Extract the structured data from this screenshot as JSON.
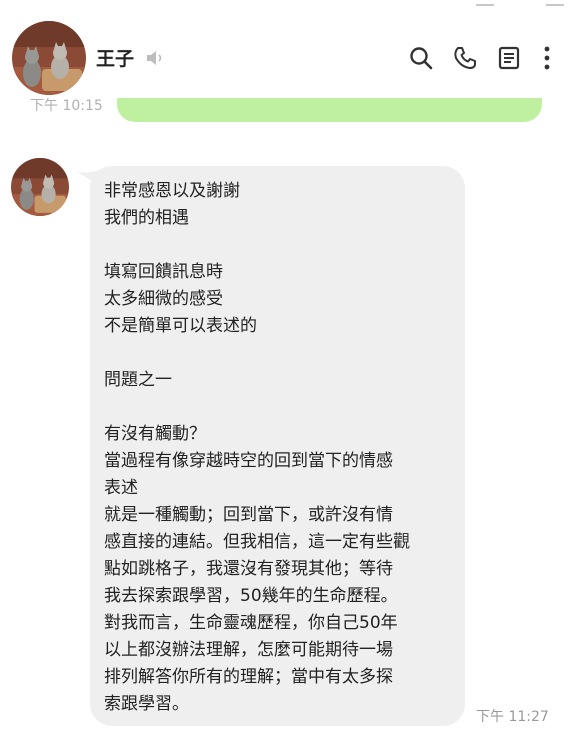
{
  "header": {
    "contact_name": "王子"
  },
  "previous_message": {
    "time": "下午 10:15"
  },
  "message": {
    "text": "非常感恩以及謝謝\n我們的相遇\n\n填寫回饋訊息時\n太多細微的感受\n不是簡單可以表述的\n\n問題之一\n\n有沒有觸動？\n當過程有像穿越時空的回到當下的情感\n表述\n就是一種觸動；回到當下，或許沒有情\n感直接的連結。但我相信，這一定有些觀\n點如跳格子，我還沒有發現其他；等待\n我去探索跟學習，50幾年的生命歷程。\n對我而言，生命靈魂歷程，你自己50年\n以上都沒辦法理解，怎麼可能期待一場\n排列解答你所有的理解；當中有太多探\n索跟學習。",
    "time": "下午 11:27"
  },
  "icons": {
    "avatar": "cat-avatar",
    "mute": "speaker-muted-icon",
    "search": "search-icon",
    "call": "phone-icon",
    "notes": "notes-icon",
    "menu": "more-vertical-icon"
  },
  "colors": {
    "incoming_bubble": "#efefef",
    "outgoing_bubble": "#bff0a0",
    "time_text": "#9a9a9a"
  }
}
